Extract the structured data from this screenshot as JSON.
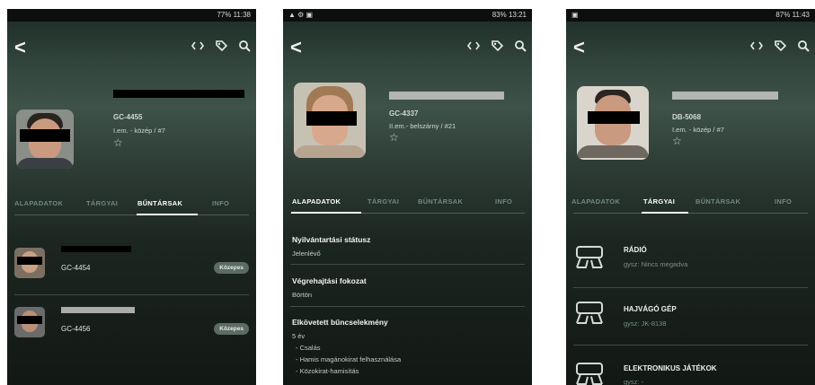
{
  "screens": [
    {
      "status": {
        "left": "",
        "right": "77% 11:38"
      },
      "profile": {
        "code": "GC-4455",
        "cell": "I.em. - közép / #7"
      },
      "tabs": [
        "ALAPADATOK",
        "TÁRGYAI",
        "BŰNTÁRSAK",
        "INFO"
      ],
      "active_tab": "BŰNTÁRSAK",
      "accomplices": [
        {
          "code": "GC-4454",
          "badge": "Közepes"
        },
        {
          "code": "GC-4456",
          "badge": "Közepes"
        }
      ]
    },
    {
      "status": {
        "left": "▲ ⚙ ▣",
        "right": "83% 13:21"
      },
      "profile": {
        "code": "GC-4337",
        "cell": "II.em.- belszárny / #21"
      },
      "tabs": [
        "ALAPADATOK",
        "TÁRGYAI",
        "BŰNTÁRSAK",
        "INFO"
      ],
      "active_tab": "ALAPADATOK",
      "fields": [
        {
          "label": "Nyilvántartási státusz",
          "value": "Jelenlévő"
        },
        {
          "label": "Végrehajtási fokozat",
          "value": "Börtön"
        },
        {
          "label": "Elkövetett bűncselekmény",
          "value": "5 év"
        }
      ],
      "crimes": [
        "- Csalás",
        "- Hamis magánokirat felhasználása",
        "- Közokirat-hamisítás"
      ]
    },
    {
      "status": {
        "left": "▣",
        "right": "87% 11:43"
      },
      "profile": {
        "code": "DB-5068",
        "cell": "I.em. - közép / #7"
      },
      "tabs": [
        "ALAPADATOK",
        "TÁRGYAI",
        "BŰNTÁRSAK",
        "INFO"
      ],
      "active_tab": "TÁRGYAI",
      "items": [
        {
          "name": "RÁDIÓ",
          "sub": "gysz: Nincs megadva"
        },
        {
          "name": "HAJVÁGÓ GÉP",
          "sub": "gysz: JK-8138"
        },
        {
          "name": "ELEKTRONIKUS JÁTÉKOK",
          "sub": "gysz: -"
        }
      ]
    }
  ],
  "icons": {
    "back": "back-arrow-icon",
    "code": "code-icon",
    "edit": "tag-edit-icon",
    "search": "search-icon",
    "favorite": "star-outline-icon",
    "item": "item-box-icon"
  },
  "colors": {
    "background_top": "#3e5249",
    "background_bottom": "#121814",
    "active_tab": "#ffffff",
    "inactive_tab": "#6f8a7d",
    "badge": "#5c6b64"
  }
}
